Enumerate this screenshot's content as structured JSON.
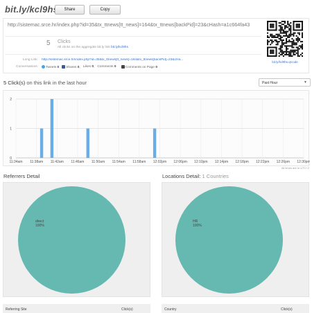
{
  "header": {
    "short_url": "bit.ly/kcl9hs",
    "share_label": "Share",
    "copy_label": "Copy"
  },
  "info": {
    "long_url": "http://sistemac.srce.hr/index.php?id=35&tx_ttnews[tt_news]=164&tx_ttnews[backPid]=23&cHash=a1c664fa43",
    "click_count": "5",
    "click_label": "Clicks",
    "aggregate_text": "All clicks on the aggregate bit.ly link",
    "aggregate_link": "bit.ly/kcl9hs",
    "long_link_label": "Long Link:",
    "long_link_value": "http://sistemac.srce.hr/index.php?id=35&tx_ttnews[tt_news]=164&tx_ttnews[backPid]=23&cHa...",
    "conversations_label": "Conversations:",
    "tweets_label": "Tweets",
    "tweets_count": "0",
    "shares_label": "Shares",
    "shares_count": "0",
    "likes_label": "Likes",
    "likes_count": "0",
    "comments_label": "Comments",
    "comments_count": "0",
    "comments_page_label": "Comments on Page",
    "comments_page_count": "0",
    "qr_link": "bit.ly/kcl9hs.qrcode"
  },
  "hour_section": {
    "title_bold": "5 Click(s)",
    "title_rest": " on this link in the last hour",
    "range_selected": "Past Hour",
    "timezone_note": "All times are in UTC+2"
  },
  "chart_data": {
    "type": "bar",
    "categories": [
      "11:34am",
      "11:38am",
      "11:42am",
      "11:46am",
      "11:50am",
      "11:54am",
      "11:58am",
      "12:02pm",
      "12:06pm",
      "12:10pm",
      "12:14pm",
      "12:18pm",
      "12:22pm",
      "12:26pm",
      "12:30pm"
    ],
    "bars": [
      {
        "x": "11:39am",
        "value": 1
      },
      {
        "x": "11:41am",
        "value": 2
      },
      {
        "x": "11:48am",
        "value": 1
      },
      {
        "x": "12:01pm",
        "value": 1
      }
    ],
    "ylim": [
      0,
      2
    ],
    "yticks": [
      "0",
      "1",
      "2"
    ],
    "grid": true,
    "bar_color": "#6aaee5"
  },
  "referrers": {
    "title": "Referrers Detail",
    "slice_label": "direct",
    "slice_pct": "100%",
    "col_site": "Referring Site",
    "col_clicks": "Click(s)"
  },
  "locations": {
    "title": "Locations Detail:",
    "subtitle": "1 Countries",
    "slice_label": "HR",
    "slice_pct": "100%",
    "col_country": "Country",
    "col_clicks": "Click(s)"
  },
  "colors": {
    "pie": "#66b9b0",
    "link": "#3b6fc4"
  }
}
